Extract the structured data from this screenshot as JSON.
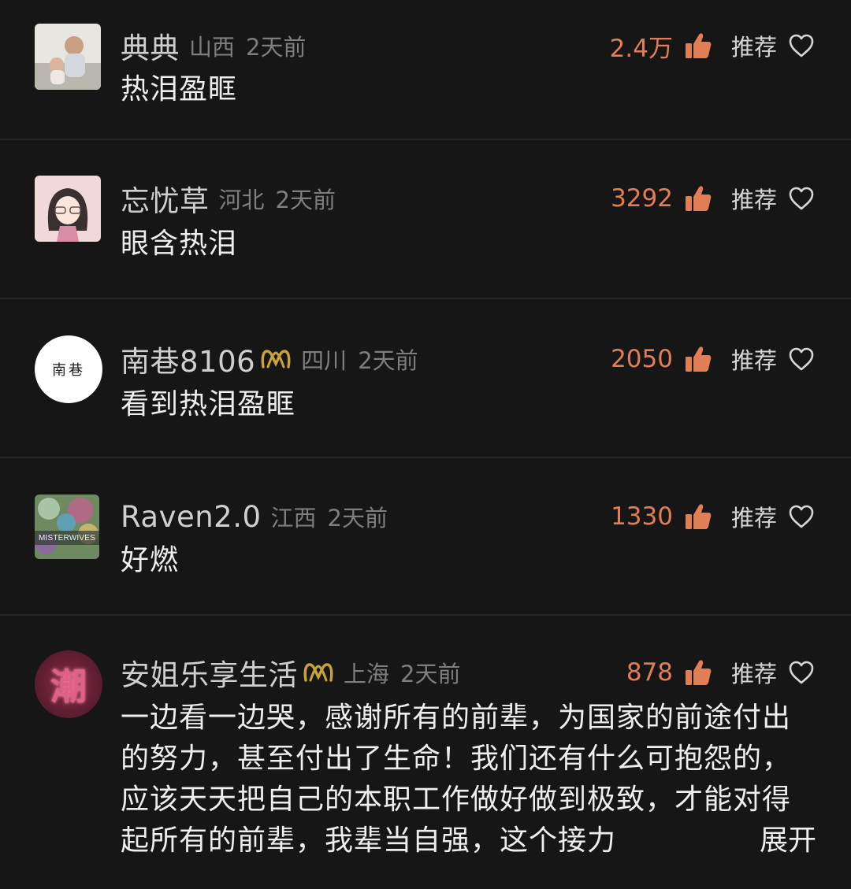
{
  "comments": [
    {
      "username": "典典",
      "location": "山西",
      "time": "2天前",
      "likes": "2.4万",
      "recommend": "推荐",
      "text": "热泪盈眶",
      "vip": false,
      "avatar": "child-photo-avatar"
    },
    {
      "username": "忘忧草",
      "location": "河北",
      "time": "2天前",
      "likes": "3292",
      "recommend": "推荐",
      "text": "眼含热泪",
      "vip": false,
      "avatar": "cartoon-girl-avatar"
    },
    {
      "username": "南巷8106",
      "location": "四川",
      "time": "2天前",
      "likes": "2050",
      "recommend": "推荐",
      "text": "看到热泪盈眶",
      "vip": true,
      "avatar": "calligraphy-avatar",
      "avatar_text": "南巷"
    },
    {
      "username": "Raven2.0",
      "location": "江西",
      "time": "2天前",
      "likes": "1330",
      "recommend": "推荐",
      "text": "好燃",
      "vip": false,
      "avatar": "album-cover-avatar",
      "avatar_text": "MISTERWIVES"
    },
    {
      "username": "安姐乐享生活",
      "location": "上海",
      "time": "2天前",
      "likes": "878",
      "recommend": "推荐",
      "text": "一边看一边哭，感谢所有的前辈，为国家的前途付出的努力，甚至付出了生命！我们还有什么可抱怨的，应该天天把自己的本职工作做好做到极致，才能对得起所有的前辈，我辈当自强，这个接力",
      "expand": "展开",
      "vip": true,
      "avatar": "red-character-avatar",
      "avatar_text": "潮"
    }
  ],
  "colors": {
    "background": "#161616",
    "like_count": "#e27e55",
    "vip_badge": "#c9a33a",
    "meta_text": "#7e7e7e"
  }
}
